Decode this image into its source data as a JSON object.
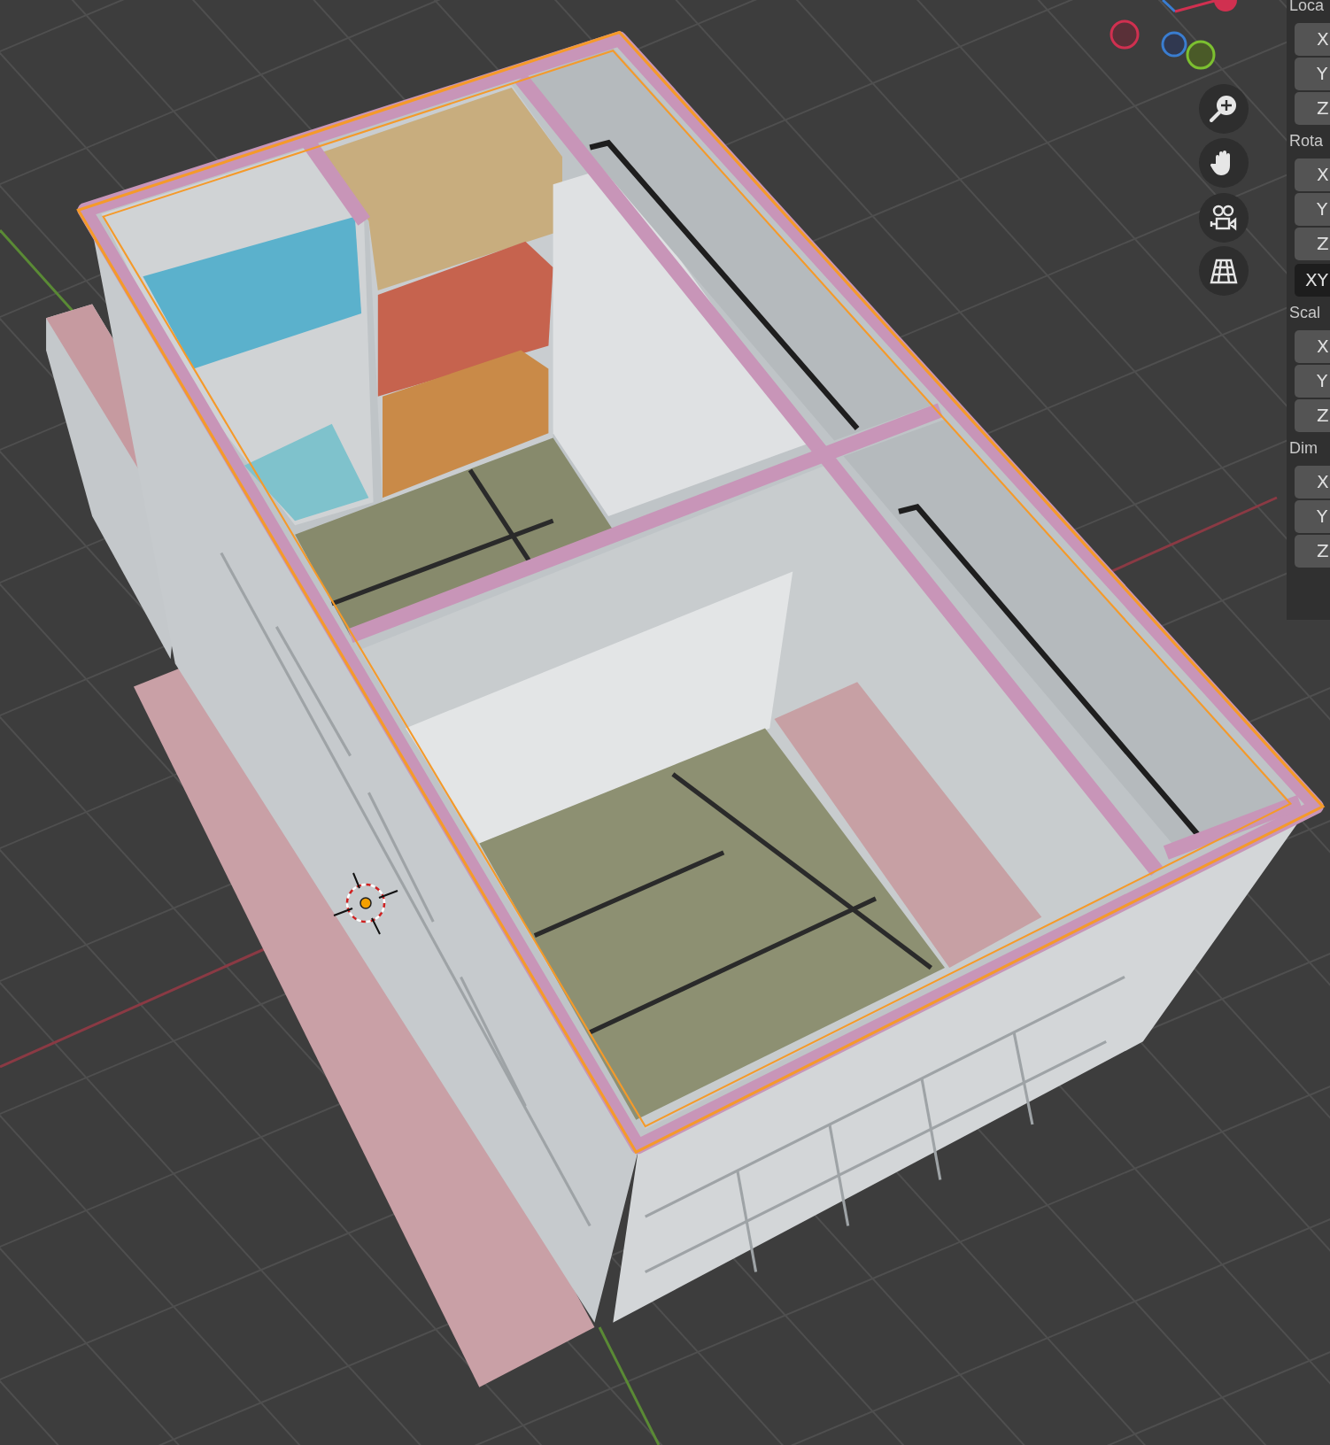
{
  "sidebar": {
    "groups": [
      {
        "label": "Loca",
        "items": [
          {
            "kind": "field",
            "label": "X"
          },
          {
            "kind": "field",
            "label": "Y"
          },
          {
            "kind": "field",
            "label": "Z"
          }
        ]
      },
      {
        "label": "Rota",
        "items": [
          {
            "kind": "field",
            "label": "X"
          },
          {
            "kind": "field",
            "label": "Y"
          },
          {
            "kind": "field",
            "label": "Z"
          },
          {
            "kind": "dropdown",
            "label": "XY"
          }
        ]
      },
      {
        "label": "Scal",
        "items": [
          {
            "kind": "field",
            "label": "X"
          },
          {
            "kind": "field",
            "label": "Y"
          },
          {
            "kind": "field",
            "label": "Z"
          }
        ]
      },
      {
        "label": "Dim",
        "items": [
          {
            "kind": "field",
            "label": "X"
          },
          {
            "kind": "field",
            "label": "Y"
          },
          {
            "kind": "field",
            "label": "Z"
          }
        ]
      }
    ]
  }
}
